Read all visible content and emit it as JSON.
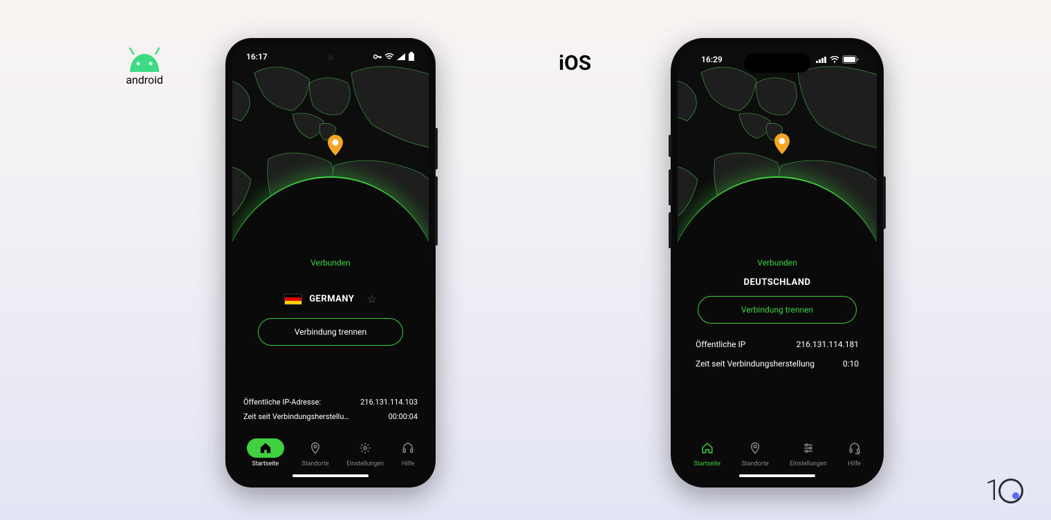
{
  "os_labels": {
    "android": "android",
    "ios": "iOS"
  },
  "android": {
    "status": {
      "time": "16:17"
    },
    "connection_status": "Verbunden",
    "country": "GERMANY",
    "disconnect_label": "Verbindung trennen",
    "info": {
      "ip_label": "Öffentliche IP-Adresse:",
      "ip_value": "216.131.114.103",
      "time_label": "Zeit seit Verbindungsherstellu…",
      "time_value": "00:00:04"
    },
    "nav": {
      "home": "Startseite",
      "locations": "Standorte",
      "settings": "Einstellungen",
      "help": "Hilfe"
    }
  },
  "ios": {
    "status": {
      "time": "16:29"
    },
    "connection_status": "Verbunden",
    "country": "DEUTSCHLAND",
    "disconnect_label": "Verbindung trennen",
    "info": {
      "ip_label": "Öffentliche IP",
      "ip_value": "216.131.114.181",
      "time_label": "Zeit seit Verbindungsherstellung",
      "time_value": "0:10"
    },
    "nav": {
      "home": "Startseite",
      "locations": "Standorte",
      "settings": "Einstellungen",
      "help": "Hilfe"
    }
  },
  "colors": {
    "accent": "#3fd13f",
    "pin": "#f5a623"
  }
}
